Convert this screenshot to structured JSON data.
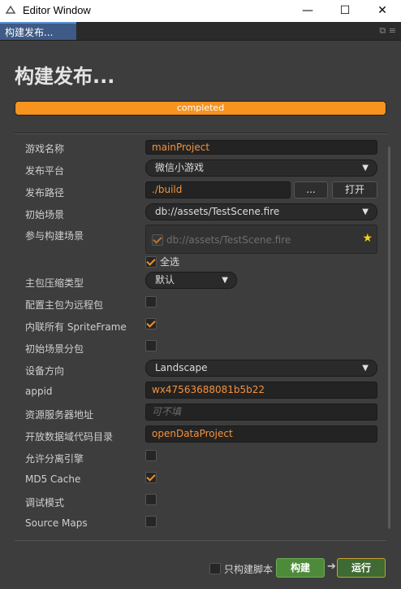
{
  "window": {
    "title": "Editor Window",
    "minimize": "—",
    "maximize": "☐",
    "close": "✕"
  },
  "tab": {
    "label": "构建发布...",
    "tools": "⧉ ≡"
  },
  "panel": {
    "title": "构建发布...",
    "progress": {
      "label": "completed",
      "fraction": 1.0
    }
  },
  "form": {
    "game_name": {
      "label": "游戏名称",
      "value": "mainProject"
    },
    "platform": {
      "label": "发布平台",
      "value": "微信小游戏"
    },
    "build_path": {
      "label": "发布路径",
      "value": "./build",
      "browse": "...",
      "open": "打开"
    },
    "start_scene": {
      "label": "初始场景",
      "value": "db://assets/TestScene.fire"
    },
    "included_scenes": {
      "label": "参与构建场景",
      "scene": "db://assets/TestScene.fire",
      "select_all": "全选"
    },
    "compression": {
      "label": "主包压缩类型",
      "value": "默认"
    },
    "remote_main": {
      "label": "配置主包为远程包"
    },
    "inline_spriteframe": {
      "label": "内联所有 SpriteFrame"
    },
    "subpackage_start": {
      "label": "初始场景分包"
    },
    "orientation": {
      "label": "设备方向",
      "value": "Landscape"
    },
    "appid": {
      "label": "appid",
      "value": "wx47563688081b5b22"
    },
    "remote_server": {
      "label": "资源服务器地址",
      "placeholder": "可不填"
    },
    "open_data": {
      "label": "开放数据域代码目录",
      "value": "openDataProject"
    },
    "separate_engine": {
      "label": "允许分离引擎"
    },
    "md5": {
      "label": "MD5 Cache"
    },
    "debug": {
      "label": "调试模式"
    },
    "source_maps": {
      "label": "Source Maps"
    }
  },
  "footer": {
    "build_only_label": "只构建脚本",
    "build": "构建",
    "arrow": "➔",
    "run": "运行"
  },
  "colors": {
    "accent": "#f7931e",
    "build_green": "#4d8b3a"
  }
}
